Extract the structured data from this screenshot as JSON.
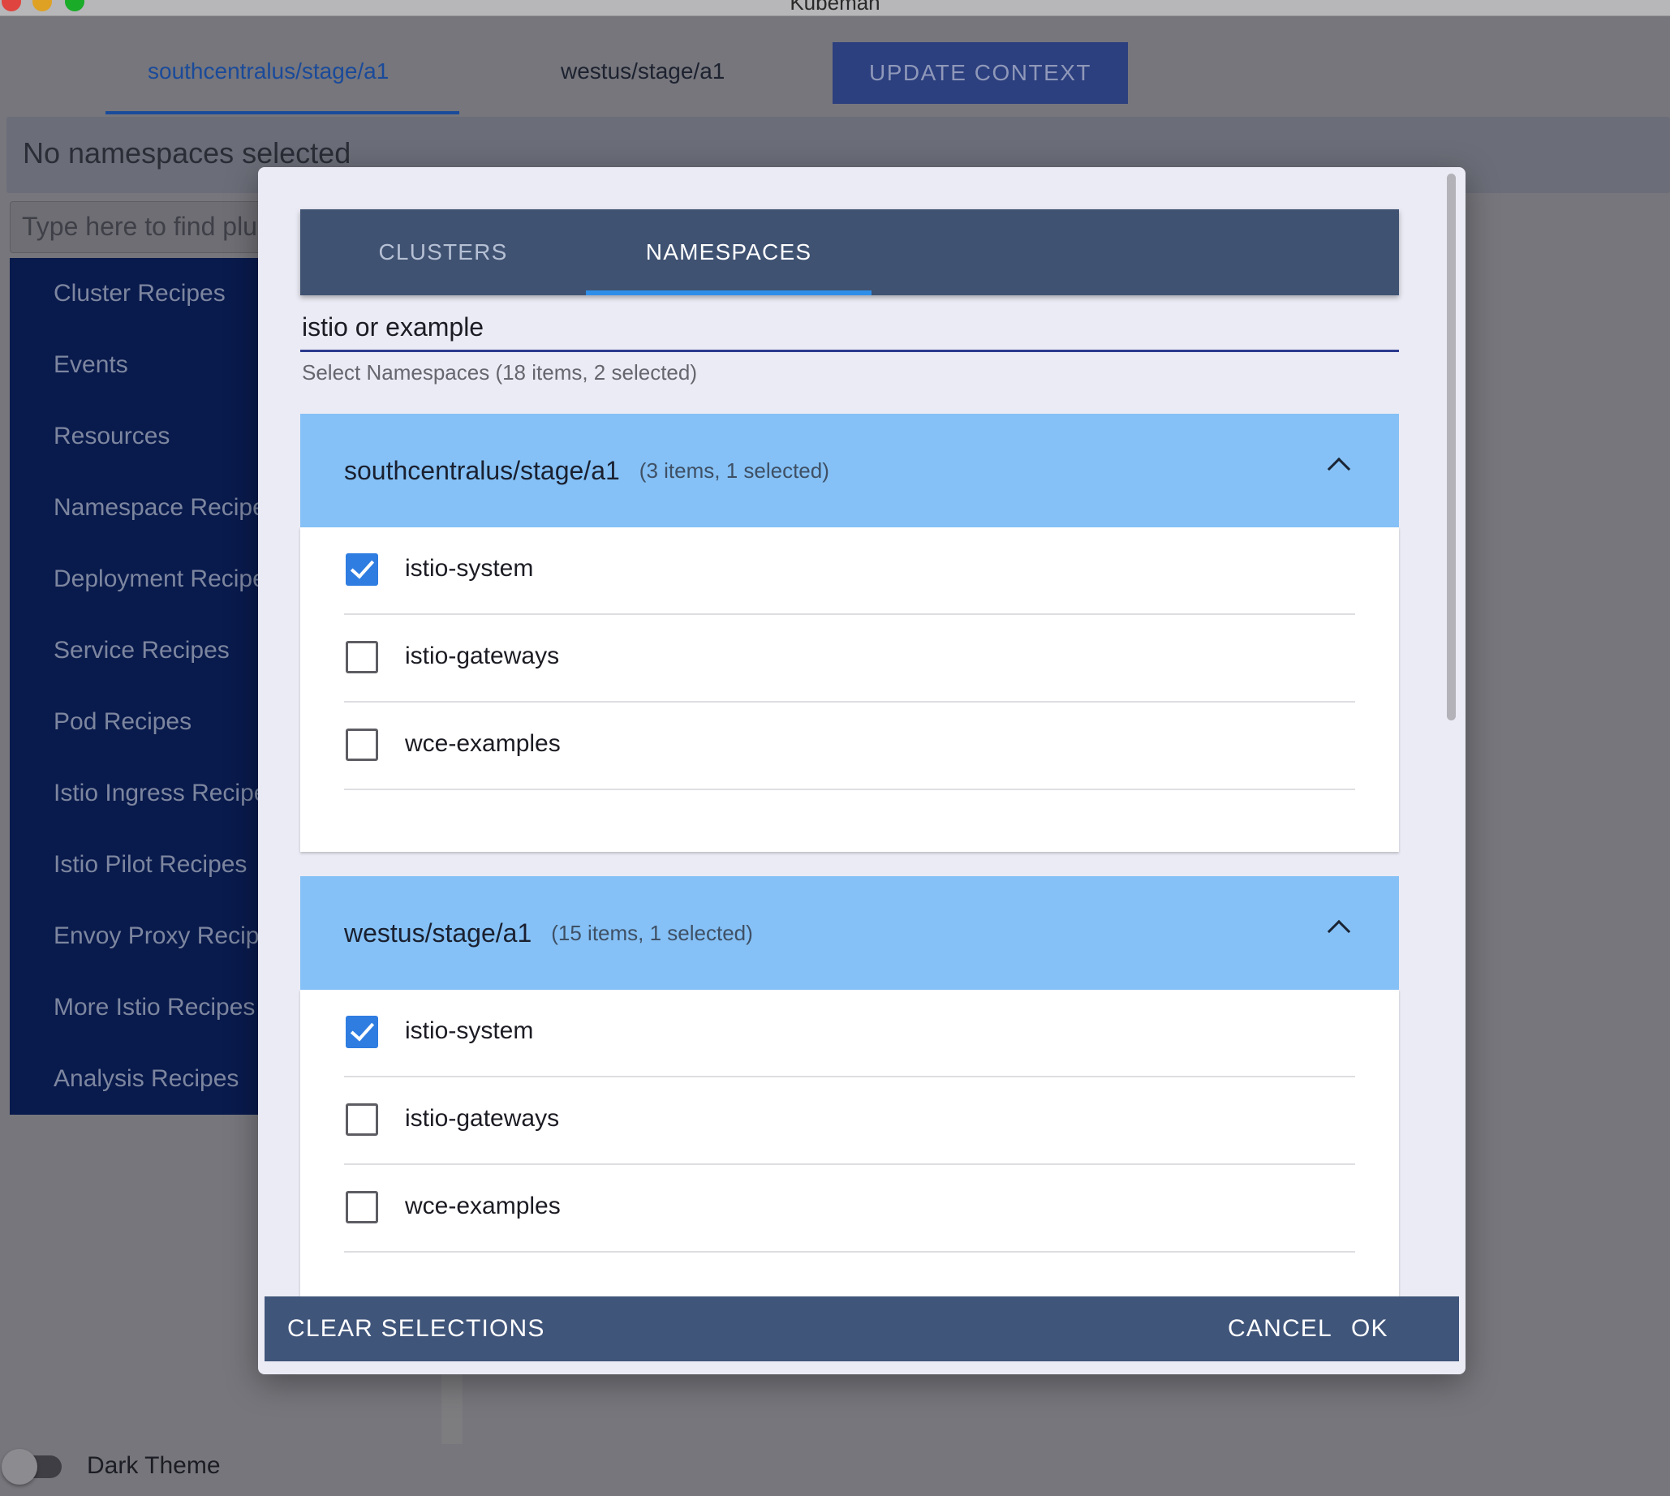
{
  "window": {
    "title": "Kubeman"
  },
  "context_tabs": [
    {
      "label": "southcentralus/stage/a1"
    },
    {
      "label": "westus/stage/a1"
    }
  ],
  "update_context_label": "UPDATE CONTEXT",
  "namespace_bar": {
    "text": "No namespaces selected"
  },
  "plugin_search": {
    "placeholder": "Type here to find plugins"
  },
  "sidebar": {
    "items": [
      {
        "label": "Cluster Recipes"
      },
      {
        "label": "Events"
      },
      {
        "label": "Resources"
      },
      {
        "label": "Namespace Recipes"
      },
      {
        "label": "Deployment Recipes"
      },
      {
        "label": "Service Recipes"
      },
      {
        "label": "Pod Recipes"
      },
      {
        "label": "Istio Ingress Recipes"
      },
      {
        "label": "Istio Pilot Recipes"
      },
      {
        "label": "Envoy Proxy Recipes"
      },
      {
        "label": "More Istio Recipes"
      },
      {
        "label": "Analysis Recipes"
      }
    ]
  },
  "theme_toggle": {
    "label": "Dark Theme",
    "on": false
  },
  "dialog": {
    "tabs": [
      {
        "label": "CLUSTERS"
      },
      {
        "label": "NAMESPACES"
      }
    ],
    "active_tab": "NAMESPACES",
    "filter_value": "istio or example",
    "hint": "Select Namespaces (18 items, 2 selected)",
    "groups": [
      {
        "title": "southcentralus/stage/a1",
        "meta": "(3 items, 1 selected)",
        "items": [
          {
            "label": "istio-system",
            "checked": true
          },
          {
            "label": "istio-gateways",
            "checked": false
          },
          {
            "label": "wce-examples",
            "checked": false
          }
        ]
      },
      {
        "title": "westus/stage/a1",
        "meta": "(15 items, 1 selected)",
        "items": [
          {
            "label": "istio-system",
            "checked": true
          },
          {
            "label": "istio-gateways",
            "checked": false
          },
          {
            "label": "wce-examples",
            "checked": false
          }
        ]
      }
    ],
    "actions": {
      "clear": "CLEAR SELECTIONS",
      "cancel": "CANCEL",
      "ok": "OK"
    }
  },
  "colors": {
    "accent": "#2f7de1",
    "tabbar": "#3f5272",
    "group_header": "#85c1f6",
    "sidebar": "#091a4c"
  }
}
